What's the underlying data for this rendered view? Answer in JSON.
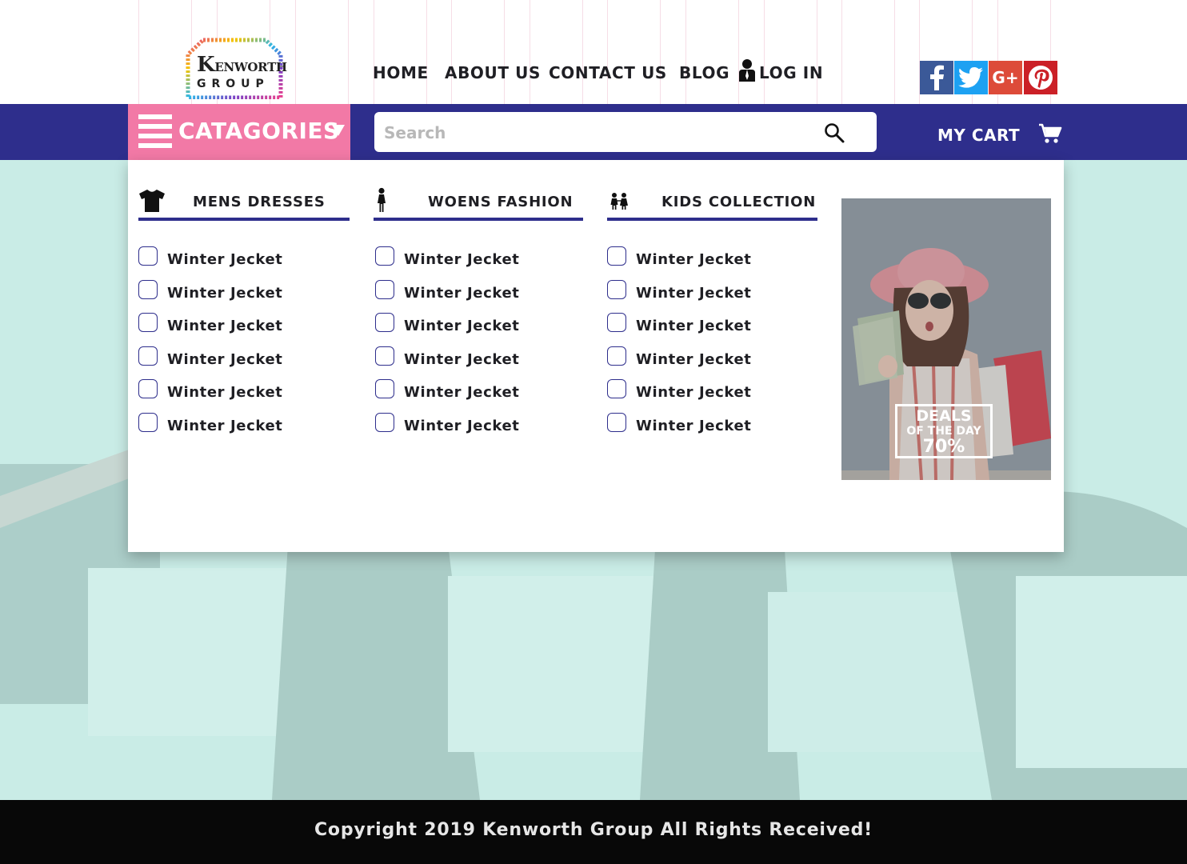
{
  "brand": {
    "logo_line1_initial": "K",
    "logo_line1_rest": "ENWORTH",
    "logo_line2": "GROUP"
  },
  "nav": {
    "home": "HOME",
    "about": "ABOUT US",
    "contact": "CONTACT US",
    "blog": "BLOG",
    "login": "LOG IN"
  },
  "social": [
    {
      "name": "facebook",
      "color": "#3b5998"
    },
    {
      "name": "twitter",
      "color": "#1da1f2"
    },
    {
      "name": "google-plus",
      "color": "#dd4b39"
    },
    {
      "name": "pinterest",
      "color": "#cb2027"
    }
  ],
  "toolbar": {
    "categories_label": "CATAGORIES",
    "search_placeholder": "Search",
    "cart_label": "MY CART"
  },
  "menu": {
    "columns": [
      {
        "title": "MENS DRESSES",
        "icon": "tshirt-icon",
        "items": [
          "Winter Jecket",
          "Winter Jecket",
          "Winter Jecket",
          "Winter Jecket",
          "Winter Jecket",
          "Winter Jecket"
        ]
      },
      {
        "title": "WOENS FASHION",
        "icon": "woman-icon",
        "items": [
          "Winter Jecket",
          "Winter Jecket",
          "Winter Jecket",
          "Winter Jecket",
          "Winter Jecket",
          "Winter Jecket"
        ]
      },
      {
        "title": "KIDS COLLECTION",
        "icon": "kids-icon",
        "items": [
          "Winter Jecket",
          "Winter Jecket",
          "Winter Jecket",
          "Winter Jecket",
          "Winter Jecket",
          "Winter Jecket"
        ]
      }
    ],
    "promo": {
      "line1": "DEALS",
      "line2": "OF THE DAY",
      "line3": "70%"
    }
  },
  "footer": {
    "copyright": "Copyright 2019 Kenworth Group All Rights Received!"
  },
  "colors": {
    "navbar": "#2e2e8c",
    "categories_bg": "#f279a6",
    "page_bg": "#c9ece6",
    "footer_bg": "#080808"
  }
}
